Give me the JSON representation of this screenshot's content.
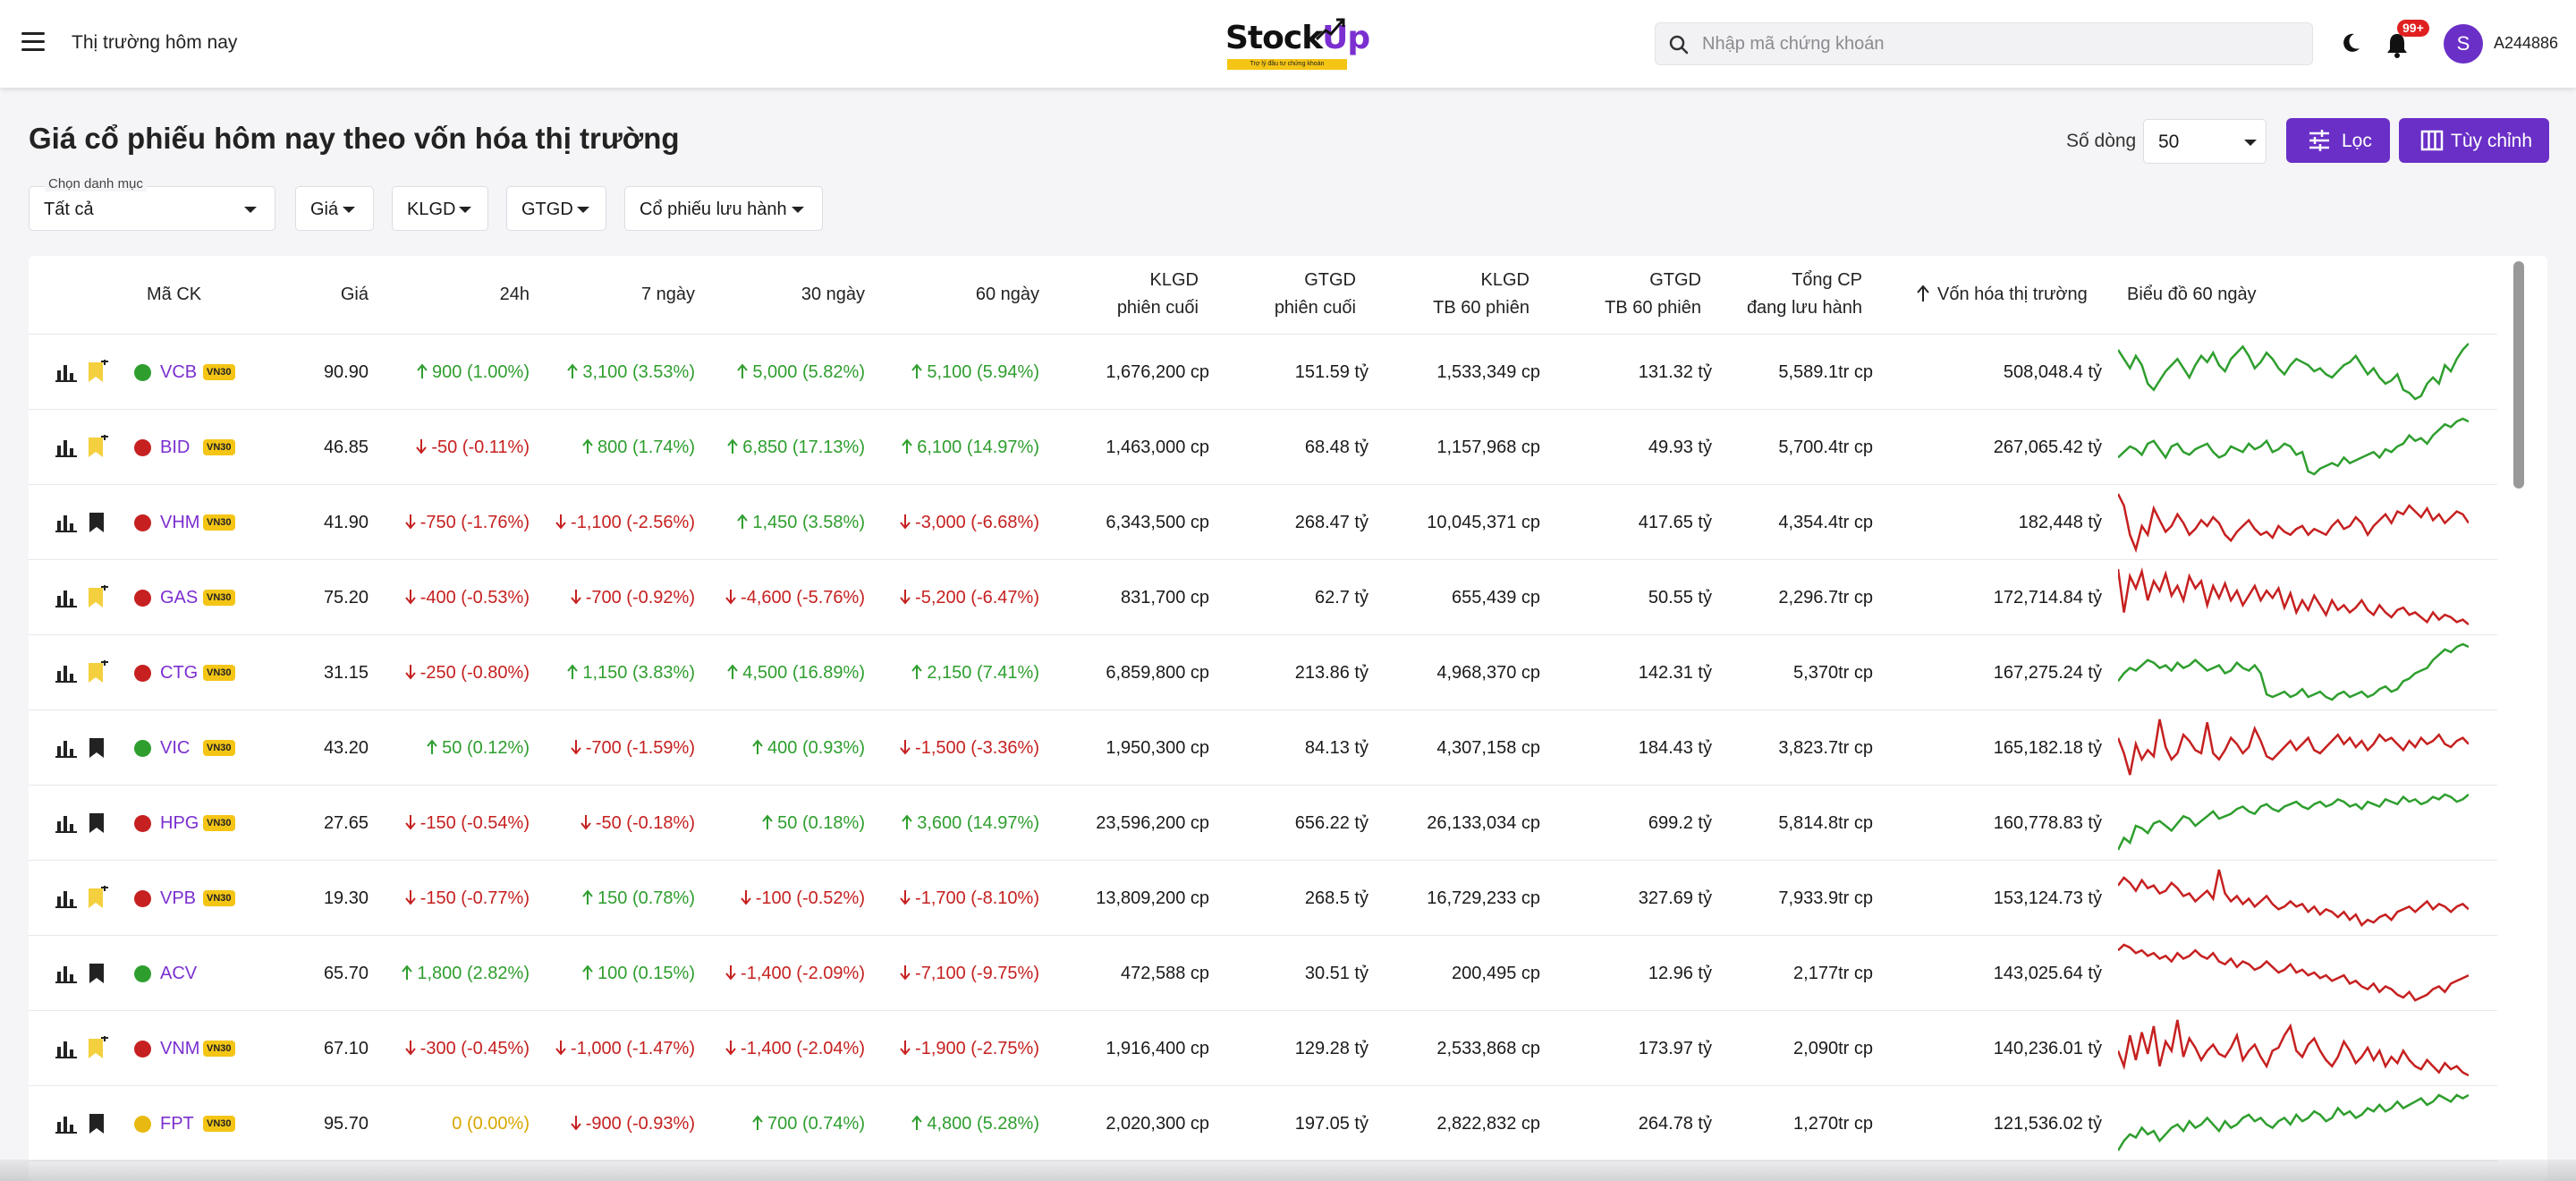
{
  "header": {
    "title": "Thị trường hôm nay",
    "logo_text_a": "Stock",
    "logo_text_b": "Up",
    "logo_tagline": "Trợ lý đầu tư chứng khoán",
    "search_placeholder": "Nhập mã chứng khoán",
    "notification_badge": "99+",
    "avatar_letter": "S",
    "username": "A244886"
  },
  "page": {
    "title": "Giá cổ phiếu hôm nay theo vốn hóa thị trường",
    "rows_label": "Số dòng",
    "rows_value": "50",
    "filter_button": "Lọc",
    "custom_button": "Tùy chỉnh"
  },
  "filters": {
    "category_label": "Chọn danh mục",
    "category_value": "Tất cả",
    "price": "Giá",
    "volume": "KLGD",
    "value": "GTGD",
    "shares": "Cổ phiếu lưu hành"
  },
  "table": {
    "headers": {
      "symbol": "Mã CK",
      "price": "Giá",
      "h24": "24h",
      "d7": "7 ngày",
      "d30": "30 ngày",
      "d60": "60 ngày",
      "vol_last_1": "KLGD",
      "vol_last_2": "phiên cuối",
      "val_last_1": "GTGD",
      "val_last_2": "phiên cuối",
      "vol_avg_1": "KLGD",
      "vol_avg_2": "TB 60 phiên",
      "val_avg_1": "GTGD",
      "val_avg_2": "TB 60 phiên",
      "shares_1": "Tổng CP",
      "shares_2": "đang lưu hành",
      "mcap": "Vốn hóa thị trường",
      "chart60": "Biểu đồ 60 ngày"
    },
    "rows": [
      {
        "sym": "VCB",
        "badge": "VN30",
        "dot": "#2e9e2e",
        "bm": "yellow",
        "price": "90.90",
        "h24": "900 (1.00%)",
        "h24d": "up",
        "d7": "3,100 (3.53%)",
        "d7d": "up",
        "d30": "5,000 (5.82%)",
        "d30d": "up",
        "d60": "5,100 (5.94%)",
        "d60d": "up",
        "vol": "1,676,200 cp",
        "val": "151.59 tỷ",
        "vavg": "1,533,349 cp",
        "valavg": "131.32 tỷ",
        "shares": "5,589.1tr cp",
        "mcap": "508,048.4 tỷ",
        "trend": "up",
        "spark": [
          8,
          14,
          20,
          12,
          18,
          30,
          34,
          28,
          22,
          18,
          14,
          20,
          26,
          18,
          12,
          16,
          10,
          18,
          22,
          14,
          10,
          6,
          12,
          20,
          16,
          10,
          14,
          20,
          24,
          18,
          14,
          16,
          18,
          22,
          20,
          24,
          26,
          22,
          18,
          16,
          12,
          18,
          24,
          20,
          26,
          30,
          28,
          24,
          34,
          36,
          40,
          38,
          30,
          26,
          30,
          18,
          22,
          14,
          8,
          4
        ]
      },
      {
        "sym": "BID",
        "badge": "VN30",
        "dot": "#c62020",
        "bm": "yellow",
        "price": "46.85",
        "h24": "-50 (-0.11%)",
        "h24d": "down",
        "d7": "800 (1.74%)",
        "d7d": "up",
        "d30": "6,850 (17.13%)",
        "d30d": "up",
        "d60": "6,100 (14.97%)",
        "d60d": "up",
        "vol": "1,463,000 cp",
        "val": "68.48 tỷ",
        "vavg": "1,157,968 cp",
        "valavg": "49.93 tỷ",
        "shares": "5,700.4tr cp",
        "mcap": "267,065.42 tỷ",
        "trend": "up",
        "spark": [
          30,
          26,
          22,
          24,
          28,
          20,
          18,
          24,
          30,
          22,
          20,
          26,
          28,
          24,
          22,
          20,
          26,
          30,
          28,
          22,
          24,
          26,
          20,
          24,
          22,
          18,
          26,
          24,
          20,
          22,
          28,
          26,
          40,
          42,
          38,
          36,
          34,
          36,
          30,
          34,
          32,
          30,
          28,
          26,
          30,
          24,
          26,
          22,
          20,
          14,
          18,
          16,
          20,
          14,
          10,
          6,
          8,
          4,
          2,
          4
        ]
      },
      {
        "sym": "VHM",
        "badge": "VN30",
        "dot": "#c62020",
        "bm": "black",
        "price": "41.90",
        "h24": "-750 (-1.76%)",
        "h24d": "down",
        "d7": "-1,100 (-2.56%)",
        "d7d": "down",
        "d30": "1,450 (3.58%)",
        "d30d": "up",
        "d60": "-3,000 (-6.68%)",
        "d60d": "down",
        "vol": "6,343,500 cp",
        "val": "268.47 tỷ",
        "vavg": "10,045,371 cp",
        "valavg": "417.65 tỷ",
        "shares": "4,354.4tr cp",
        "mcap": "182,448 tỷ",
        "trend": "down",
        "spark": [
          2,
          10,
          30,
          40,
          24,
          30,
          12,
          20,
          28,
          24,
          16,
          22,
          30,
          26,
          20,
          24,
          18,
          22,
          30,
          34,
          28,
          24,
          20,
          26,
          30,
          28,
          32,
          24,
          28,
          30,
          26,
          24,
          30,
          26,
          28,
          30,
          24,
          20,
          26,
          24,
          18,
          22,
          30,
          24,
          20,
          16,
          22,
          14,
          16,
          10,
          14,
          18,
          12,
          20,
          16,
          22,
          18,
          14,
          16,
          22
        ]
      },
      {
        "sym": "GAS",
        "badge": "VN30",
        "dot": "#c62020",
        "bm": "yellow",
        "price": "75.20",
        "h24": "-400 (-0.53%)",
        "h24d": "down",
        "d7": "-700 (-0.92%)",
        "d7d": "down",
        "d30": "-4,600 (-5.76%)",
        "d30d": "down",
        "d60": "-5,200 (-6.47%)",
        "d60d": "down",
        "vol": "831,700 cp",
        "val": "62.7 tỷ",
        "vavg": "655,439 cp",
        "valavg": "50.55 tỷ",
        "shares": "2,296.7tr cp",
        "mcap": "172,714.84 tỷ",
        "trend": "down",
        "spark": [
          4,
          40,
          10,
          20,
          6,
          30,
          14,
          22,
          8,
          26,
          18,
          30,
          10,
          20,
          14,
          34,
          18,
          28,
          16,
          30,
          22,
          34,
          26,
          18,
          30,
          22,
          28,
          20,
          36,
          24,
          40,
          30,
          38,
          26,
          34,
          42,
          30,
          38,
          34,
          40,
          36,
          30,
          38,
          42,
          34,
          40,
          44,
          38,
          36,
          42,
          40,
          44,
          48,
          40,
          46,
          42,
          44,
          48,
          46,
          50
        ]
      },
      {
        "sym": "CTG",
        "badge": "VN30",
        "dot": "#c62020",
        "bm": "yellow",
        "price": "31.15",
        "h24": "-250 (-0.80%)",
        "h24d": "down",
        "d7": "1,150 (3.83%)",
        "d7d": "up",
        "d30": "4,500 (16.89%)",
        "d30d": "up",
        "d60": "2,150 (7.41%)",
        "d60d": "up",
        "vol": "6,859,800 cp",
        "val": "213.86 tỷ",
        "vavg": "4,968,370 cp",
        "valavg": "142.31 tỷ",
        "shares": "5,370tr cp",
        "mcap": "167,275.24 tỷ",
        "trend": "up",
        "spark": [
          30,
          24,
          20,
          22,
          18,
          14,
          16,
          20,
          18,
          22,
          16,
          20,
          18,
          14,
          18,
          22,
          20,
          18,
          24,
          22,
          16,
          20,
          22,
          18,
          24,
          40,
          42,
          40,
          38,
          42,
          40,
          36,
          42,
          40,
          38,
          42,
          44,
          40,
          38,
          42,
          40,
          38,
          42,
          40,
          36,
          34,
          38,
          36,
          30,
          28,
          24,
          22,
          20,
          14,
          10,
          6,
          8,
          4,
          2,
          4
        ]
      },
      {
        "sym": "VIC",
        "badge": "VN30",
        "dot": "#2e9e2e",
        "bm": "black",
        "price": "43.20",
        "h24": "50 (0.12%)",
        "h24d": "up",
        "d7": "-700 (-1.59%)",
        "d7d": "down",
        "d30": "400 (0.93%)",
        "d30d": "up",
        "d60": "-1,500 (-3.36%)",
        "d60d": "down",
        "vol": "1,950,300 cp",
        "val": "84.13 tỷ",
        "vavg": "4,307,158 cp",
        "valavg": "184.43 tỷ",
        "shares": "3,823.7tr cp",
        "mcap": "165,182.18 tỷ",
        "trend": "down",
        "spark": [
          20,
          30,
          44,
          24,
          34,
          28,
          32,
          8,
          26,
          34,
          30,
          18,
          22,
          28,
          30,
          10,
          30,
          34,
          28,
          20,
          24,
          30,
          26,
          14,
          22,
          32,
          34,
          30,
          26,
          22,
          28,
          24,
          20,
          28,
          30,
          26,
          22,
          18,
          24,
          20,
          26,
          22,
          28,
          24,
          18,
          22,
          20,
          24,
          28,
          22,
          26,
          20,
          24,
          22,
          18,
          24,
          26,
          22,
          20,
          24
        ]
      },
      {
        "sym": "HPG",
        "badge": "VN30",
        "dot": "#c62020",
        "bm": "black",
        "price": "27.65",
        "h24": "-150 (-0.54%)",
        "h24d": "down",
        "d7": "-50 (-0.18%)",
        "d7d": "down",
        "d30": "50 (0.18%)",
        "d30d": "up",
        "d60": "3,600 (14.97%)",
        "d60d": "up",
        "vol": "23,596,200 cp",
        "val": "656.22 tỷ",
        "vavg": "26,133,034 cp",
        "valavg": "699.2 tỷ",
        "shares": "5,814.8tr cp",
        "mcap": "160,778.83 tỷ",
        "trend": "up",
        "spark": [
          50,
          40,
          44,
          30,
          32,
          36,
          28,
          26,
          30,
          34,
          28,
          22,
          24,
          30,
          26,
          22,
          18,
          24,
          22,
          20,
          16,
          14,
          18,
          20,
          14,
          12,
          16,
          18,
          14,
          12,
          10,
          14,
          16,
          12,
          10,
          14,
          12,
          8,
          10,
          14,
          12,
          16,
          10,
          12,
          14,
          8,
          10,
          12,
          6,
          10,
          8,
          12,
          10,
          6,
          8,
          4,
          6,
          10,
          8,
          4
        ]
      },
      {
        "sym": "VPB",
        "badge": "VN30",
        "dot": "#c62020",
        "bm": "yellow",
        "price": "19.30",
        "h24": "-150 (-0.77%)",
        "h24d": "down",
        "d7": "150 (0.78%)",
        "d7d": "up",
        "d30": "-100 (-0.52%)",
        "d30d": "down",
        "d60": "-1,700 (-8.10%)",
        "d60d": "down",
        "vol": "13,809,200 cp",
        "val": "268.5 tỷ",
        "vavg": "16,729,233 cp",
        "valavg": "327.69 tỷ",
        "shares": "7,933.9tr cp",
        "mcap": "153,124.73 tỷ",
        "trend": "down",
        "spark": [
          14,
          8,
          12,
          18,
          10,
          16,
          14,
          20,
          18,
          12,
          16,
          22,
          20,
          26,
          22,
          18,
          24,
          2,
          20,
          26,
          22,
          28,
          24,
          30,
          26,
          22,
          28,
          32,
          30,
          26,
          30,
          28,
          34,
          30,
          36,
          32,
          34,
          38,
          34,
          40,
          36,
          44,
          40,
          42,
          38,
          36,
          40,
          34,
          32,
          30,
          34,
          30,
          26,
          32,
          28,
          30,
          34,
          30,
          28,
          32
        ]
      },
      {
        "sym": "ACV",
        "badge": "",
        "dot": "#2e9e2e",
        "bm": "black",
        "price": "65.70",
        "h24": "1,800 (2.82%)",
        "h24d": "up",
        "d7": "100 (0.15%)",
        "d7d": "up",
        "d30": "-1,400 (-2.09%)",
        "d30d": "down",
        "d60": "-7,100 (-9.75%)",
        "d60d": "down",
        "vol": "472,588 cp",
        "val": "30.51 tỷ",
        "vavg": "200,495 cp",
        "valavg": "12.96 tỷ",
        "shares": "2,177tr cp",
        "mcap": "143,025.64 tỷ",
        "trend": "down",
        "spark": [
          10,
          6,
          8,
          12,
          10,
          14,
          12,
          16,
          14,
          18,
          12,
          16,
          14,
          10,
          14,
          16,
          12,
          18,
          20,
          16,
          22,
          18,
          20,
          24,
          22,
          18,
          22,
          26,
          24,
          20,
          26,
          24,
          28,
          26,
          30,
          28,
          32,
          30,
          28,
          34,
          32,
          36,
          38,
          34,
          40,
          36,
          38,
          42,
          44,
          40,
          46,
          44,
          42,
          38,
          36,
          40,
          34,
          32,
          30,
          28
        ]
      },
      {
        "sym": "VNM",
        "badge": "VN30",
        "dot": "#c62020",
        "bm": "yellow",
        "price": "67.10",
        "h24": "-300 (-0.45%)",
        "h24d": "down",
        "d7": "-1,000 (-1.47%)",
        "d7d": "down",
        "d30": "-1,400 (-2.04%)",
        "d30d": "down",
        "d60": "-1,900 (-2.75%)",
        "d60d": "down",
        "vol": "1,916,400 cp",
        "val": "129.28 tỷ",
        "vavg": "2,533,868 cp",
        "valavg": "173.97 tỷ",
        "shares": "2,090tr cp",
        "mcap": "140,236.01 tỷ",
        "trend": "down",
        "spark": [
          30,
          40,
          20,
          36,
          18,
          32,
          14,
          40,
          24,
          30,
          10,
          34,
          22,
          28,
          36,
          30,
          26,
          32,
          34,
          28,
          20,
          36,
          30,
          26,
          34,
          40,
          30,
          28,
          20,
          14,
          30,
          34,
          26,
          22,
          30,
          36,
          40,
          34,
          24,
          30,
          38,
          34,
          28,
          36,
          30,
          40,
          34,
          38,
          30,
          36,
          40,
          42,
          36,
          40,
          44,
          38,
          42,
          40,
          44,
          46
        ]
      },
      {
        "sym": "FPT",
        "badge": "VN30",
        "dot": "#e8b910",
        "bm": "black",
        "price": "95.70",
        "h24": "0 (0.00%)",
        "h24d": "ref",
        "d7": "-900 (-0.93%)",
        "d7d": "down",
        "d30": "700 (0.74%)",
        "d30d": "up",
        "d60": "4,800 (5.28%)",
        "d60d": "up",
        "vol": "2,020,300 cp",
        "val": "197.05 tỷ",
        "vavg": "2,822,832 cp",
        "valavg": "264.78 tỷ",
        "shares": "1,270tr cp",
        "mcap": "121,536.02 tỷ",
        "trend": "up",
        "spark": [
          40,
          34,
          30,
          32,
          26,
          30,
          28,
          34,
          30,
          26,
          24,
          28,
          22,
          26,
          24,
          20,
          24,
          28,
          22,
          26,
          24,
          20,
          18,
          22,
          20,
          24,
          26,
          22,
          20,
          24,
          18,
          22,
          20,
          16,
          18,
          22,
          20,
          14,
          18,
          16,
          20,
          18,
          14,
          16,
          12,
          16,
          14,
          10,
          14,
          12,
          10,
          8,
          12,
          10,
          6,
          8,
          10,
          6,
          8,
          6
        ]
      }
    ]
  },
  "colors": {
    "accent": "#6a2fc7",
    "up": "#2e9e2e",
    "down": "#c62020",
    "ref": "#d9a600",
    "vn30_badge": "#f4c515"
  }
}
